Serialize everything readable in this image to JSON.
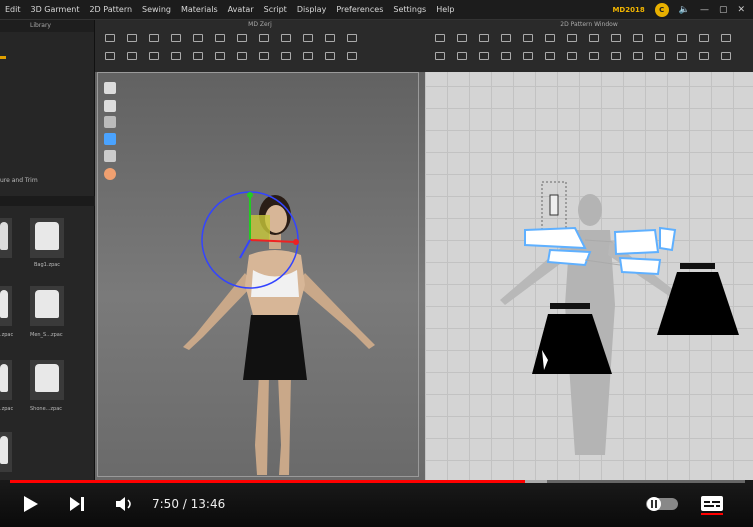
{
  "menu": [
    "Edit",
    "3D Garment",
    "2D Pattern",
    "Sewing",
    "Materials",
    "Avatar",
    "Script",
    "Display",
    "Preferences",
    "Settings",
    "Help"
  ],
  "version_badge": "MD2018",
  "library": {
    "title": "Library",
    "section": "ure and Trim"
  },
  "viewport3d": {
    "title": "MD Zerj"
  },
  "viewport2d": {
    "title": "2D Pattern Window"
  },
  "thumbs": [
    "Bag1.zpac",
    "Men_S...zpac",
    "Shone...zpac",
    ".zpac",
    ".zpac",
    ".zpac"
  ],
  "player": {
    "current": "7:50",
    "duration": "13:46",
    "progress": 0.7,
    "buffered": 0.73
  },
  "colors": {
    "accent": "#ff0000",
    "skirt": "#000000",
    "gizmo_blue": "#3344ff",
    "gizmo_green": "#22cc22",
    "gizmo_red": "#ee2222"
  }
}
